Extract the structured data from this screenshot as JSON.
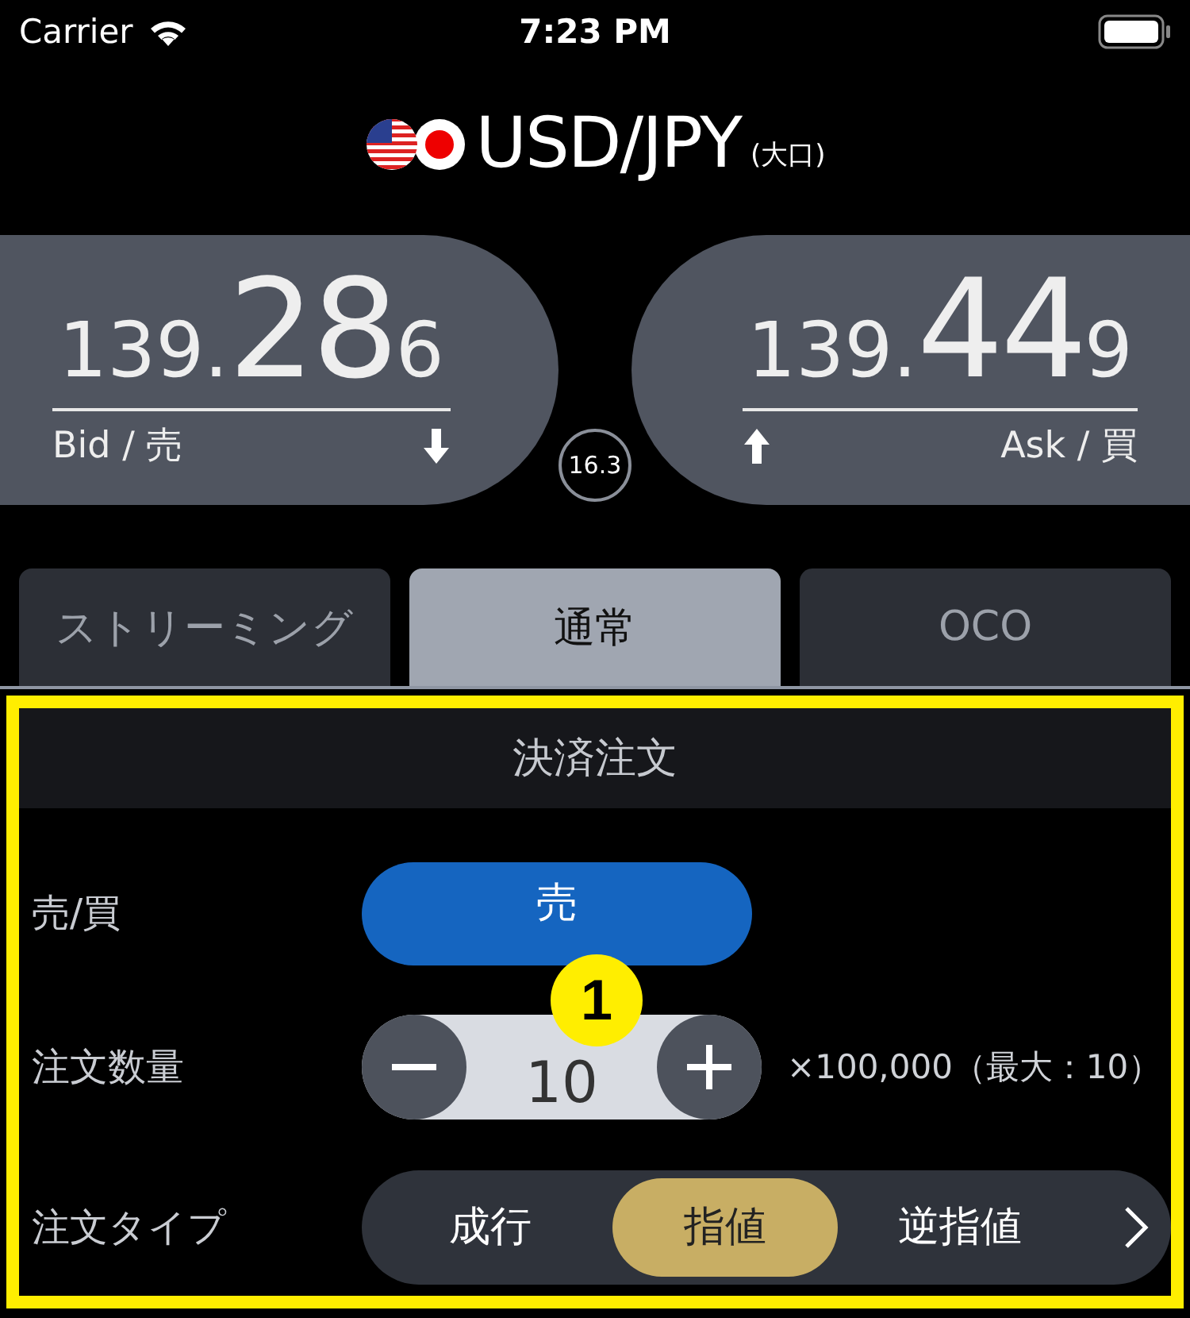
{
  "status_bar": {
    "carrier": "Carrier",
    "time": "7:23 PM"
  },
  "header": {
    "pair": "USD/JPY",
    "note": "(大口)"
  },
  "bid": {
    "prefix": "139.",
    "big": "28",
    "suffix": "6",
    "label": "Bid / 売"
  },
  "ask": {
    "prefix": "139.",
    "big": "44",
    "suffix": "9",
    "label": "Ask / 買"
  },
  "spread": "16.3",
  "tabs": [
    {
      "label": "ストリーミング",
      "selected": false
    },
    {
      "label": "通常",
      "selected": true
    },
    {
      "label": "OCO",
      "selected": false
    }
  ],
  "section_title": "決済注文",
  "side": {
    "label": "売/買",
    "value": "売"
  },
  "quantity": {
    "label": "注文数量",
    "value": "10",
    "unit": "×100,000（最大：10）"
  },
  "order_type": {
    "label": "注文タイプ",
    "options": [
      {
        "label": "成行",
        "selected": false
      },
      {
        "label": "指値",
        "selected": true
      },
      {
        "label": "逆指値",
        "selected": false
      }
    ]
  },
  "callout": "1"
}
